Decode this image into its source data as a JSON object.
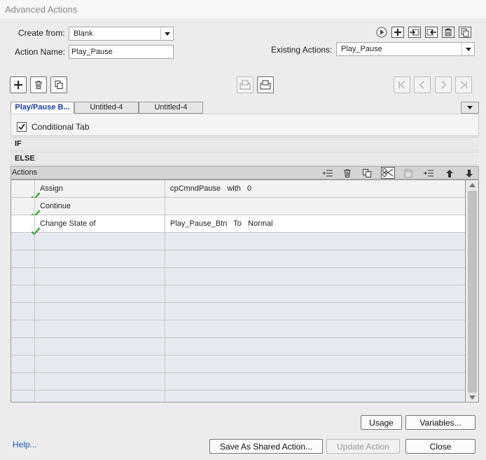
{
  "window": {
    "title": "Advanced Actions"
  },
  "form": {
    "create_from_label": "Create from:",
    "create_from_value": "Blank",
    "action_name_label": "Action Name:",
    "action_name_value": "Play_Pause",
    "existing_label": "Existing Actions:",
    "existing_value": "Play_Pause"
  },
  "tabs": [
    {
      "label": "Play/Pause B...",
      "active": true
    },
    {
      "label": "Untitled-4",
      "active": false
    },
    {
      "label": "Untitled-4",
      "active": false
    }
  ],
  "conditional": {
    "label": "Conditional Tab",
    "checked": true
  },
  "sections": {
    "if_label": "IF",
    "else_label": "ELSE",
    "actions_label": "Actions"
  },
  "actions": [
    {
      "status": "check-icon",
      "action": "Assign",
      "params": "cpCmndPause   with   0"
    },
    {
      "status": "check-icon",
      "action": "Continue",
      "params": ""
    },
    {
      "status": "check-icon",
      "action": "Change State of",
      "params": "Play_Pause_Btn   To   Normal"
    }
  ],
  "buttons": {
    "usage": "Usage",
    "variables": "Variables...",
    "help": "Help...",
    "save_shared": "Save As Shared Action...",
    "update": "Update Action",
    "close": "Close"
  },
  "colors": {
    "active_tab": "#1a3fa8",
    "check": "#3aa53a",
    "link": "#1d5ea8"
  }
}
